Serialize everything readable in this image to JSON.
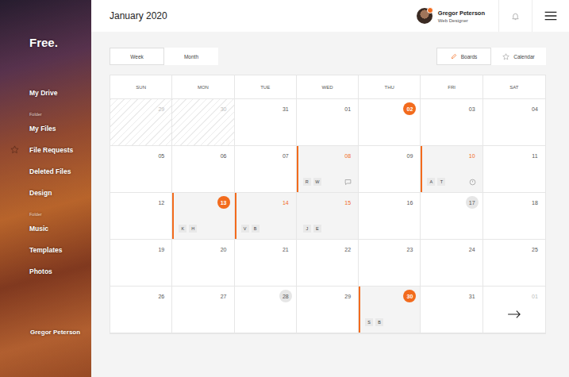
{
  "logo": "Free.",
  "sidebar": {
    "items": [
      {
        "label": "My Drive",
        "kind": "link",
        "selected": false
      },
      {
        "label": "Folder",
        "kind": "heading",
        "selected": false
      },
      {
        "label": "My Files",
        "kind": "link",
        "selected": false
      },
      {
        "label": "File Requests",
        "kind": "link",
        "selected": true
      },
      {
        "label": "Deleted Files",
        "kind": "link",
        "selected": false
      },
      {
        "label": "Design",
        "kind": "link",
        "selected": false
      },
      {
        "label": "Folder",
        "kind": "heading",
        "selected": false
      },
      {
        "label": "Music",
        "kind": "link",
        "selected": false
      },
      {
        "label": "Templates",
        "kind": "link",
        "selected": false
      },
      {
        "label": "Photos",
        "kind": "link",
        "selected": false
      }
    ],
    "user": "Gregor Peterson"
  },
  "header": {
    "title": "January 2020",
    "user": {
      "name": "Gregor Peterson",
      "role": "Web Designer",
      "online": true
    }
  },
  "view_tabs": [
    {
      "label": "Week",
      "selected": true
    },
    {
      "label": "Month",
      "selected": false
    }
  ],
  "actions": [
    {
      "label": "Boards",
      "selected": true
    },
    {
      "label": "Calendar",
      "selected": false
    }
  ],
  "calendar": {
    "weekdays": [
      "SUN",
      "MON",
      "TUE",
      "WED",
      "THU",
      "FRI",
      "SAT"
    ],
    "weeks": [
      [
        {
          "day": "29",
          "kind": "outside",
          "hatched": true,
          "event": false,
          "flagged": false,
          "tags": [],
          "extra": "none",
          "nav": false
        },
        {
          "day": "30",
          "kind": "outside",
          "hatched": true,
          "event": false,
          "flagged": false,
          "tags": [],
          "extra": "none",
          "nav": false
        },
        {
          "day": "31",
          "kind": "plain",
          "hatched": false,
          "event": false,
          "flagged": false,
          "tags": [],
          "extra": "none",
          "nav": false
        },
        {
          "day": "01",
          "kind": "plain",
          "hatched": false,
          "event": false,
          "flagged": false,
          "tags": [],
          "extra": "none",
          "nav": false
        },
        {
          "day": "02",
          "kind": "filled",
          "hatched": false,
          "event": false,
          "flagged": false,
          "tags": [],
          "extra": "none",
          "nav": false
        },
        {
          "day": "03",
          "kind": "plain",
          "hatched": false,
          "event": false,
          "flagged": false,
          "tags": [],
          "extra": "none",
          "nav": false
        },
        {
          "day": "04",
          "kind": "plain",
          "hatched": false,
          "event": false,
          "flagged": false,
          "tags": [],
          "extra": "none",
          "nav": false
        }
      ],
      [
        {
          "day": "05",
          "kind": "plain",
          "hatched": false,
          "event": false,
          "flagged": false,
          "tags": [],
          "extra": "none",
          "nav": false
        },
        {
          "day": "06",
          "kind": "plain",
          "hatched": false,
          "event": false,
          "flagged": false,
          "tags": [],
          "extra": "none",
          "nav": false
        },
        {
          "day": "07",
          "kind": "plain",
          "hatched": false,
          "event": false,
          "flagged": false,
          "tags": [],
          "extra": "none",
          "nav": false
        },
        {
          "day": "08",
          "kind": "accent",
          "hatched": false,
          "event": true,
          "flagged": true,
          "tags": [
            "R",
            "W"
          ],
          "extra": "comment",
          "nav": false
        },
        {
          "day": "09",
          "kind": "plain",
          "hatched": false,
          "event": false,
          "flagged": false,
          "tags": [],
          "extra": "none",
          "nav": false
        },
        {
          "day": "10",
          "kind": "accent",
          "hatched": false,
          "event": true,
          "flagged": true,
          "tags": [
            "A",
            "T"
          ],
          "extra": "reminder",
          "nav": false
        },
        {
          "day": "11",
          "kind": "plain",
          "hatched": false,
          "event": false,
          "flagged": false,
          "tags": [],
          "extra": "none",
          "nav": false
        }
      ],
      [
        {
          "day": "12",
          "kind": "plain",
          "hatched": false,
          "event": false,
          "flagged": false,
          "tags": [],
          "extra": "none",
          "nav": false
        },
        {
          "day": "13",
          "kind": "filled",
          "hatched": false,
          "event": true,
          "flagged": true,
          "tags": [
            "K",
            "H"
          ],
          "extra": "none",
          "nav": false
        },
        {
          "day": "14",
          "kind": "accent",
          "hatched": false,
          "event": true,
          "flagged": true,
          "tags": [
            "V",
            "B"
          ],
          "extra": "none",
          "nav": false
        },
        {
          "day": "15",
          "kind": "accent",
          "hatched": false,
          "event": true,
          "flagged": false,
          "tags": [
            "J",
            "E"
          ],
          "extra": "none",
          "nav": false
        },
        {
          "day": "16",
          "kind": "plain",
          "hatched": false,
          "event": false,
          "flagged": false,
          "tags": [],
          "extra": "none",
          "nav": false
        },
        {
          "day": "17",
          "kind": "ringed",
          "hatched": false,
          "event": false,
          "flagged": false,
          "tags": [],
          "extra": "none",
          "nav": false
        },
        {
          "day": "18",
          "kind": "plain",
          "hatched": false,
          "event": false,
          "flagged": false,
          "tags": [],
          "extra": "none",
          "nav": false
        }
      ],
      [
        {
          "day": "19",
          "kind": "plain",
          "hatched": false,
          "event": false,
          "flagged": false,
          "tags": [],
          "extra": "none",
          "nav": false
        },
        {
          "day": "20",
          "kind": "plain",
          "hatched": false,
          "event": false,
          "flagged": false,
          "tags": [],
          "extra": "none",
          "nav": false
        },
        {
          "day": "21",
          "kind": "plain",
          "hatched": false,
          "event": false,
          "flagged": false,
          "tags": [],
          "extra": "none",
          "nav": false
        },
        {
          "day": "22",
          "kind": "plain",
          "hatched": false,
          "event": false,
          "flagged": false,
          "tags": [],
          "extra": "none",
          "nav": false
        },
        {
          "day": "23",
          "kind": "plain",
          "hatched": false,
          "event": false,
          "flagged": false,
          "tags": [],
          "extra": "none",
          "nav": false
        },
        {
          "day": "24",
          "kind": "plain",
          "hatched": false,
          "event": false,
          "flagged": false,
          "tags": [],
          "extra": "none",
          "nav": false
        },
        {
          "day": "25",
          "kind": "plain",
          "hatched": false,
          "event": false,
          "flagged": false,
          "tags": [],
          "extra": "none",
          "nav": false
        }
      ],
      [
        {
          "day": "26",
          "kind": "plain",
          "hatched": false,
          "event": false,
          "flagged": false,
          "tags": [],
          "extra": "none",
          "nav": false
        },
        {
          "day": "27",
          "kind": "plain",
          "hatched": false,
          "event": false,
          "flagged": false,
          "tags": [],
          "extra": "none",
          "nav": false
        },
        {
          "day": "28",
          "kind": "ringed",
          "hatched": false,
          "event": false,
          "flagged": false,
          "tags": [],
          "extra": "none",
          "nav": false
        },
        {
          "day": "29",
          "kind": "plain",
          "hatched": false,
          "event": false,
          "flagged": false,
          "tags": [],
          "extra": "none",
          "nav": false
        },
        {
          "day": "30",
          "kind": "filled",
          "hatched": false,
          "event": true,
          "flagged": true,
          "tags": [
            "S",
            "B"
          ],
          "extra": "none",
          "nav": false
        },
        {
          "day": "31",
          "kind": "plain",
          "hatched": false,
          "event": false,
          "flagged": false,
          "tags": [],
          "extra": "none",
          "nav": false
        },
        {
          "day": "01",
          "kind": "outside",
          "hatched": false,
          "event": false,
          "flagged": false,
          "tags": [],
          "extra": "none",
          "nav": true
        }
      ]
    ]
  }
}
